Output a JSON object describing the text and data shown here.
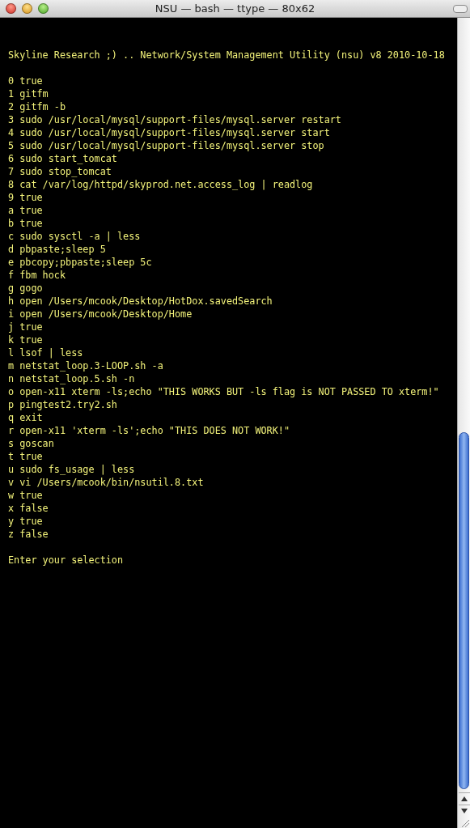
{
  "window": {
    "title": "NSU — bash — ttype — 80x62"
  },
  "terminal": {
    "banner": "Skyline Research ;) .. Network/System Management Utility (nsu) v8 2010-10-18",
    "menu_items": [
      {
        "key": "0",
        "command": "true"
      },
      {
        "key": "1",
        "command": "gitfm"
      },
      {
        "key": "2",
        "command": "gitfm -b"
      },
      {
        "key": "3",
        "command": "sudo /usr/local/mysql/support-files/mysql.server restart"
      },
      {
        "key": "4",
        "command": "sudo /usr/local/mysql/support-files/mysql.server start"
      },
      {
        "key": "5",
        "command": "sudo /usr/local/mysql/support-files/mysql.server stop"
      },
      {
        "key": "6",
        "command": "sudo start_tomcat"
      },
      {
        "key": "7",
        "command": "sudo stop_tomcat"
      },
      {
        "key": "8",
        "command": "cat /var/log/httpd/skyprod.net.access_log | readlog"
      },
      {
        "key": "9",
        "command": "true"
      },
      {
        "key": "a",
        "command": "true"
      },
      {
        "key": "b",
        "command": "true"
      },
      {
        "key": "c",
        "command": "sudo sysctl -a | less"
      },
      {
        "key": "d",
        "command": "pbpaste;sleep 5"
      },
      {
        "key": "e",
        "command": "pbcopy;pbpaste;sleep 5c"
      },
      {
        "key": "f",
        "command": "fbm hock"
      },
      {
        "key": "g",
        "command": "gogo"
      },
      {
        "key": "h",
        "command": "open /Users/mcook/Desktop/HotDox.savedSearch"
      },
      {
        "key": "i",
        "command": "open /Users/mcook/Desktop/Home"
      },
      {
        "key": "j",
        "command": "true"
      },
      {
        "key": "k",
        "command": "true"
      },
      {
        "key": "l",
        "command": "lsof | less"
      },
      {
        "key": "m",
        "command": "netstat_loop.3-LOOP.sh -a"
      },
      {
        "key": "n",
        "command": "netstat_loop.5.sh -n"
      },
      {
        "key": "o",
        "command": "open-x11 xterm -ls;echo \"THIS WORKS BUT -ls flag is NOT PASSED TO xterm!\""
      },
      {
        "key": "p",
        "command": "pingtest2.try2.sh"
      },
      {
        "key": "q",
        "command": "exit"
      },
      {
        "key": "r",
        "command": "open-x11 'xterm -ls';echo \"THIS DOES NOT WORK!\""
      },
      {
        "key": "s",
        "command": "goscan"
      },
      {
        "key": "t",
        "command": "true"
      },
      {
        "key": "u",
        "command": "sudo fs_usage | less"
      },
      {
        "key": "v",
        "command": "vi /Users/mcook/bin/nsutil.8.txt"
      },
      {
        "key": "w",
        "command": "true"
      },
      {
        "key": "x",
        "command": "false"
      },
      {
        "key": "y",
        "command": "true"
      },
      {
        "key": "z",
        "command": "false"
      }
    ],
    "prompt": "Enter your selection"
  }
}
